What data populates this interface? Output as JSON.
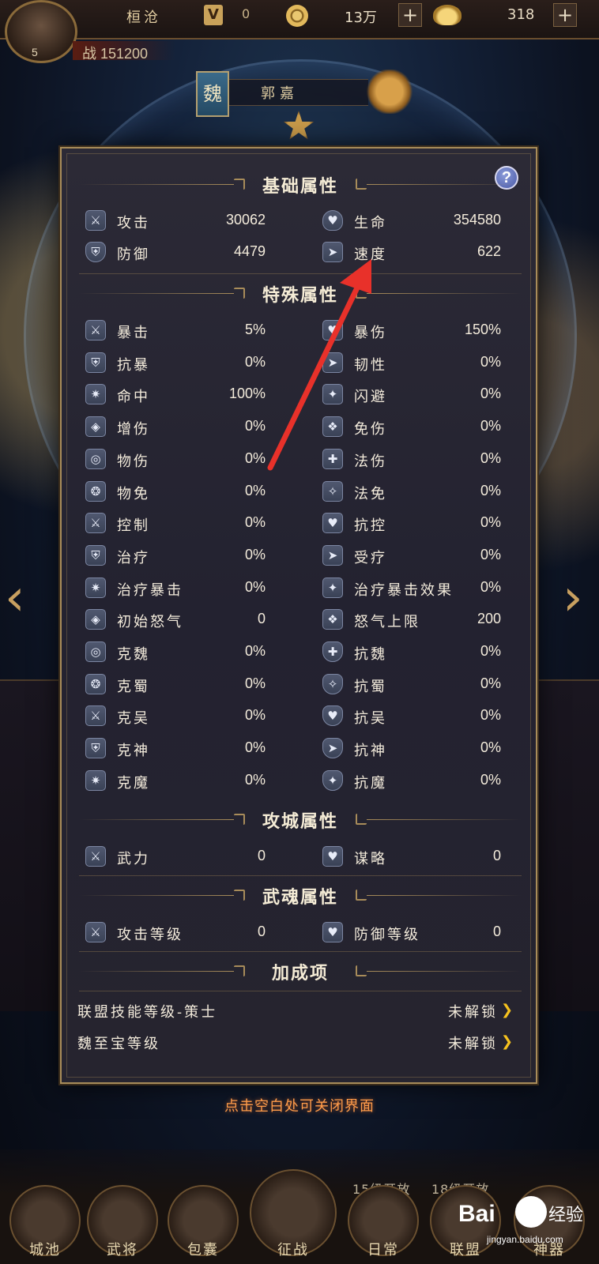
{
  "player": {
    "name": "桓沧",
    "level": "5",
    "vip_level": "0",
    "vip_label": "V",
    "coins": "13万",
    "ingots": "318",
    "power": "战 151200"
  },
  "hero": {
    "faction": "魏",
    "name": "郭嘉"
  },
  "modal": {
    "help_label": "?",
    "sections": {
      "basic": "基础属性",
      "special": "特殊属性",
      "siege": "攻城属性",
      "soul": "武魂属性",
      "bonus": "加成项"
    },
    "basic_stats": [
      {
        "label": "攻击",
        "value": "30062",
        "icon": "attack-icon"
      },
      {
        "label": "生命",
        "value": "354580",
        "icon": "heart-icon"
      },
      {
        "label": "防御",
        "value": "4479",
        "icon": "shield-icon"
      },
      {
        "label": "速度",
        "value": "622",
        "icon": "speed-icon"
      }
    ],
    "special_stats": [
      {
        "label": "暴击",
        "value": "5%",
        "icon": "crit-icon"
      },
      {
        "label": "暴伤",
        "value": "150%",
        "icon": "crit-damage-icon"
      },
      {
        "label": "抗暴",
        "value": "0%",
        "icon": "crit-resist-icon"
      },
      {
        "label": "韧性",
        "value": "0%",
        "icon": "tenacity-icon"
      },
      {
        "label": "命中",
        "value": "100%",
        "icon": "hit-icon"
      },
      {
        "label": "闪避",
        "value": "0%",
        "icon": "dodge-icon"
      },
      {
        "label": "增伤",
        "value": "0%",
        "icon": "damage-boost-icon"
      },
      {
        "label": "免伤",
        "value": "0%",
        "icon": "damage-reduce-icon"
      },
      {
        "label": "物伤",
        "value": "0%",
        "icon": "physical-damage-icon"
      },
      {
        "label": "法伤",
        "value": "0%",
        "icon": "magic-damage-icon"
      },
      {
        "label": "物免",
        "value": "0%",
        "icon": "physical-resist-icon"
      },
      {
        "label": "法免",
        "value": "0%",
        "icon": "magic-resist-icon"
      },
      {
        "label": "控制",
        "value": "0%",
        "icon": "control-icon"
      },
      {
        "label": "抗控",
        "value": "0%",
        "icon": "control-resist-icon"
      },
      {
        "label": "治疗",
        "value": "0%",
        "icon": "heal-icon"
      },
      {
        "label": "受疗",
        "value": "0%",
        "icon": "heal-received-icon"
      },
      {
        "label": "治疗暴击",
        "value": "0%",
        "icon": "heal-crit-icon"
      },
      {
        "label": "治疗暴击效果",
        "value": "0%",
        "icon": "heal-crit-effect-icon"
      },
      {
        "label": "初始怒气",
        "value": "0",
        "icon": "initial-rage-icon"
      },
      {
        "label": "怒气上限",
        "value": "200",
        "icon": "rage-cap-icon"
      },
      {
        "label": "克魏",
        "value": "0%",
        "icon": "counter-wei-icon"
      },
      {
        "label": "抗魏",
        "value": "0%",
        "icon": "resist-wei-icon"
      },
      {
        "label": "克蜀",
        "value": "0%",
        "icon": "counter-shu-icon"
      },
      {
        "label": "抗蜀",
        "value": "0%",
        "icon": "resist-shu-icon"
      },
      {
        "label": "克吴",
        "value": "0%",
        "icon": "counter-wu-icon"
      },
      {
        "label": "抗吴",
        "value": "0%",
        "icon": "resist-wu-icon"
      },
      {
        "label": "克神",
        "value": "0%",
        "icon": "counter-god-icon"
      },
      {
        "label": "抗神",
        "value": "0%",
        "icon": "resist-god-icon"
      },
      {
        "label": "克魔",
        "value": "0%",
        "icon": "counter-demon-icon"
      },
      {
        "label": "抗魔",
        "value": "0%",
        "icon": "resist-demon-icon"
      }
    ],
    "siege_stats": [
      {
        "label": "武力",
        "value": "0",
        "icon": "might-icon"
      },
      {
        "label": "谋略",
        "value": "0",
        "icon": "strategy-icon"
      }
    ],
    "soul_stats": [
      {
        "label": "攻击等级",
        "value": "0",
        "icon": "attack-level-icon"
      },
      {
        "label": "防御等级",
        "value": "0",
        "icon": "defense-level-icon"
      }
    ],
    "bonus_items": [
      {
        "label": "联盟技能等级-策士",
        "status": "未解锁"
      },
      {
        "label": "魏至宝等级",
        "status": "未解锁"
      }
    ]
  },
  "close_hint": "点击空白处可关闭界面",
  "bottom_nav": [
    {
      "label": "城池"
    },
    {
      "label": "武将"
    },
    {
      "label": "包囊"
    },
    {
      "label": "征战"
    },
    {
      "label": "日常"
    },
    {
      "label": "联盟"
    },
    {
      "label": "神器"
    }
  ],
  "lock_hints": [
    "15级开放",
    "18级开放"
  ],
  "watermark": {
    "text": "Bai",
    "suffix": "经验",
    "url": "jingyan.baidu.com"
  },
  "colors": {
    "modal_border": "#a88c5a",
    "annotation_arrow": "#e8312a",
    "close_hint": "#ff9c4a",
    "unlock_arrow": "#f6c21e"
  }
}
